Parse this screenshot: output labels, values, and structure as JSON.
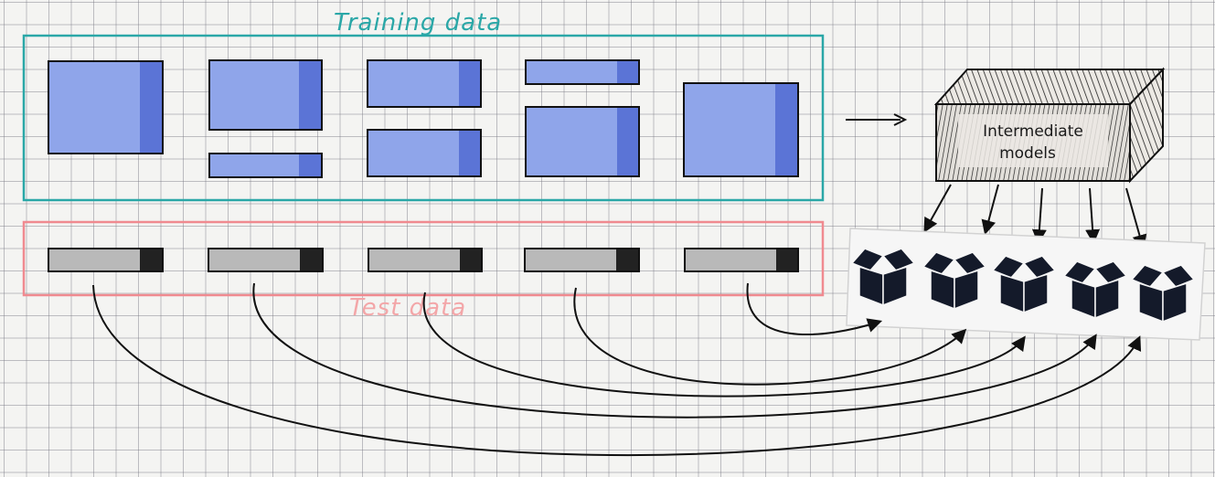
{
  "labels": {
    "training": "Training data",
    "test": "Test data",
    "model_line1": "Intermediate",
    "model_line2": "models"
  },
  "colors": {
    "training_border": "#2aa7a7",
    "test_border": "#f08a90",
    "fold_fill": "#8fa5ea",
    "fold_dark": "#5b74d6",
    "test_fill": "#b9b9b9",
    "test_dark": "#222222",
    "ink": "#111111",
    "box_icon": "#141a2a"
  },
  "icons": {
    "arrow": "arrow-right-icon",
    "model": "model-block-icon",
    "box": "box-icon"
  }
}
